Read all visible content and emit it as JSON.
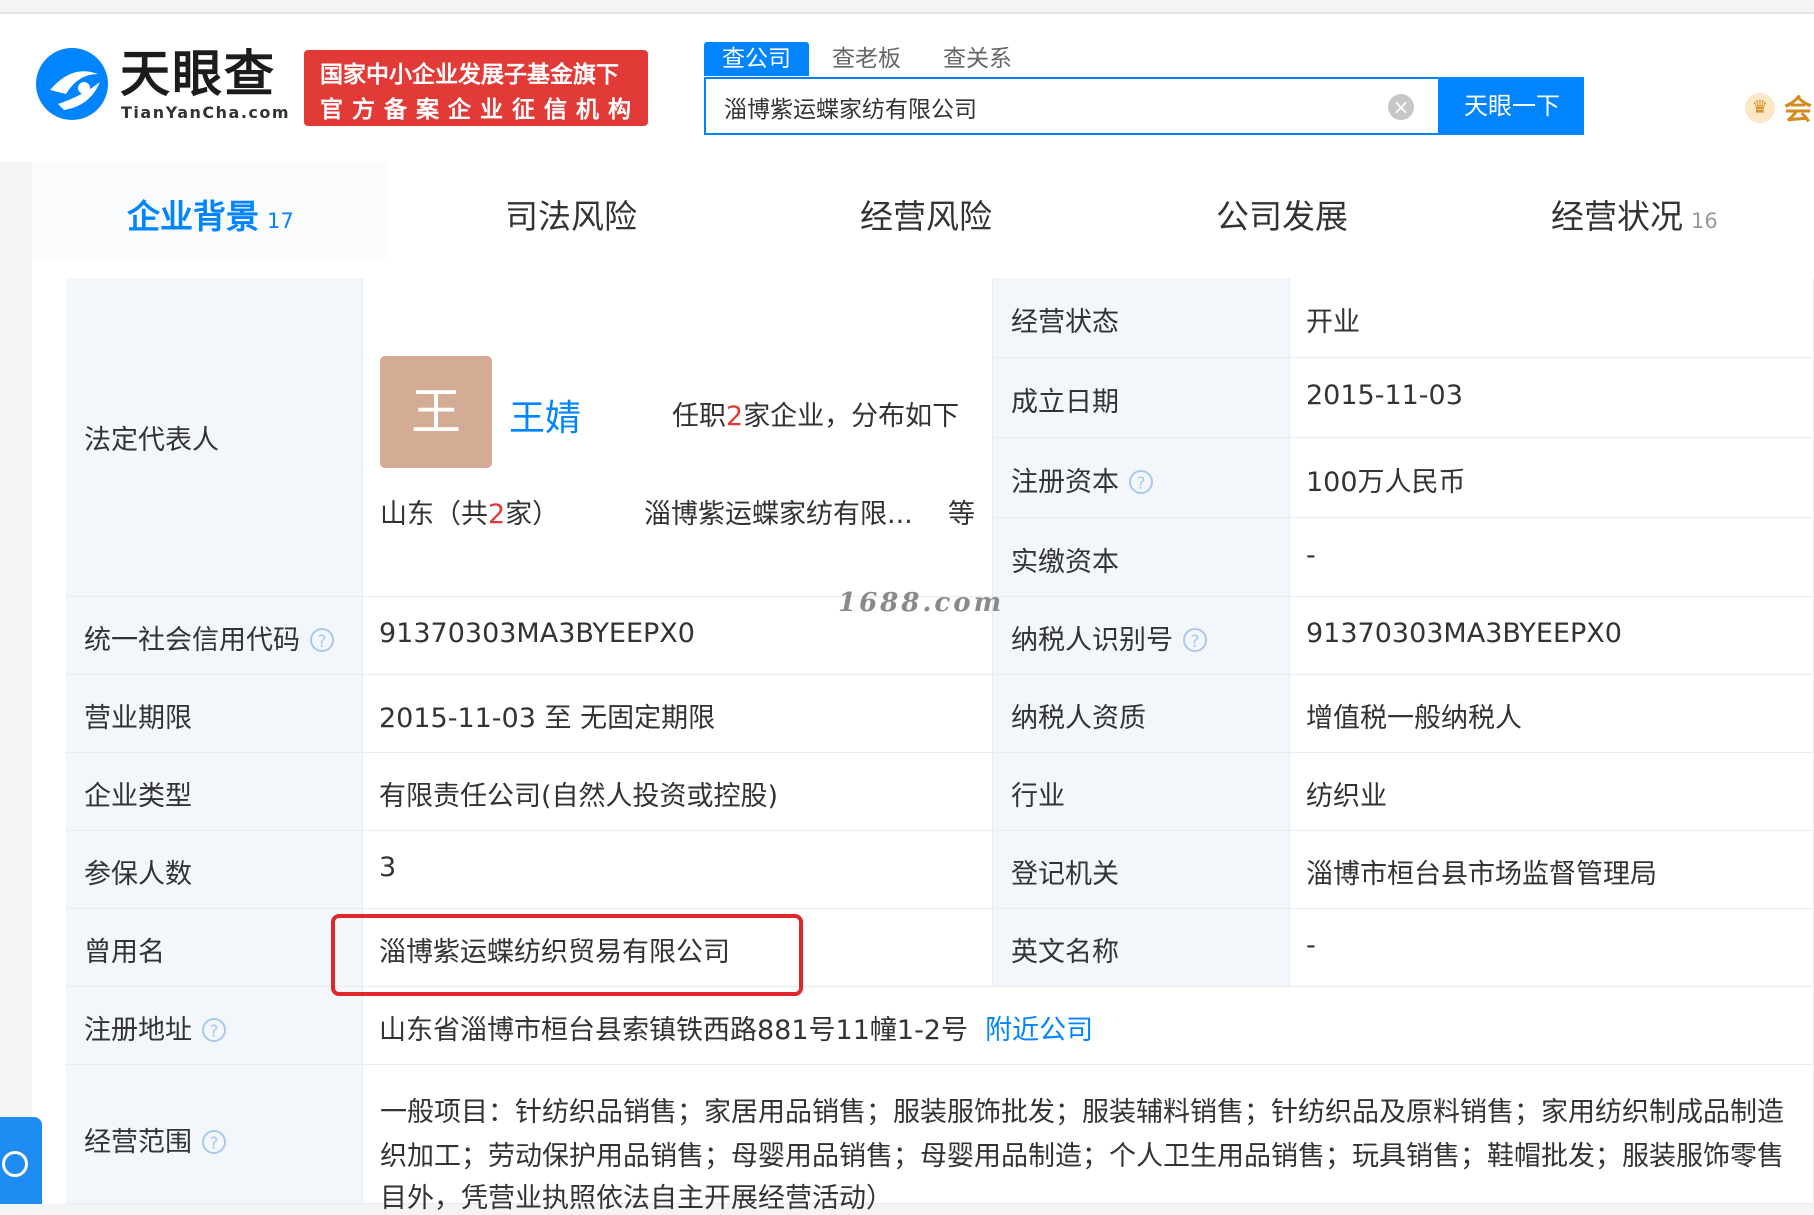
{
  "header": {
    "logo_text": "天眼查",
    "logo_domain": "TianYanCha.com",
    "badge_line1": "国家中小企业发展子基金旗下",
    "badge_line2": "官方备案企业征信机构",
    "search_tabs": [
      "查公司",
      "查老板",
      "查关系"
    ],
    "search_value": "淄博紫运蝶家纺有限公司",
    "search_button": "天眼一下",
    "vip_label": "会"
  },
  "tabs": [
    {
      "label": "企业背景",
      "count": "17"
    },
    {
      "label": "司法风险",
      "count": ""
    },
    {
      "label": "经营风险",
      "count": ""
    },
    {
      "label": "公司发展",
      "count": ""
    },
    {
      "label": "经营状况",
      "count": "16"
    }
  ],
  "legal_rep": {
    "label": "法定代表人",
    "avatar": "王",
    "name": "王婧",
    "positions_prefix": "任职",
    "positions_count": "2",
    "positions_suffix": "家企业，分布如下",
    "region_prefix": "山东（共",
    "region_count": "2",
    "region_suffix": "家）",
    "companies": "淄博紫运蝶家纺有限...",
    "etc": "等"
  },
  "right_top": [
    {
      "label": "经营状态",
      "value": "开业",
      "help": false
    },
    {
      "label": "成立日期",
      "value": "2015-11-03",
      "help": false
    },
    {
      "label": "注册资本",
      "value": "100万人民币",
      "help": true
    },
    {
      "label": "实缴资本",
      "value": "-",
      "help": false
    }
  ],
  "rows": [
    {
      "l1": "统一社会信用代码",
      "h1": true,
      "v1": "91370303MA3BYEEPX0",
      "l2": "纳税人识别号",
      "h2": true,
      "v2": "91370303MA3BYEEPX0"
    },
    {
      "l1": "营业期限",
      "h1": false,
      "v1": "2015-11-03 至 无固定期限",
      "l2": "纳税人资质",
      "h2": false,
      "v2": "增值税一般纳税人"
    },
    {
      "l1": "企业类型",
      "h1": false,
      "v1": "有限责任公司(自然人投资或控股)",
      "l2": "行业",
      "h2": false,
      "v2": "纺织业"
    },
    {
      "l1": "参保人数",
      "h1": false,
      "v1": "3",
      "l2": "登记机关",
      "h2": false,
      "v2": "淄博市桓台县市场监督管理局"
    },
    {
      "l1": "曾用名",
      "h1": false,
      "v1": "淄博紫运蝶纺织贸易有限公司",
      "l2": "英文名称",
      "h2": false,
      "v2": "-"
    }
  ],
  "address": {
    "label": "注册地址",
    "value": "山东省淄博市桓台县索镇铁西路881号11幢1-2号",
    "link": "附近公司"
  },
  "scope": {
    "label": "经营范围",
    "lines": [
      "一般项目：针纺织品销售；家居用品销售；服装服饰批发；服装辅料销售；针纺织品及原料销售；家用纺织制成品制造",
      "织加工；劳动保护用品销售；母婴用品销售；母婴用品制造；个人卫生用品销售；玩具销售；鞋帽批发；服装服饰零售",
      "目外，凭营业执照依法自主开展经营活动）"
    ]
  },
  "watermark": "1688.com",
  "help_glyph": "?",
  "clear_glyph": "×",
  "vip_glyph": "♛"
}
